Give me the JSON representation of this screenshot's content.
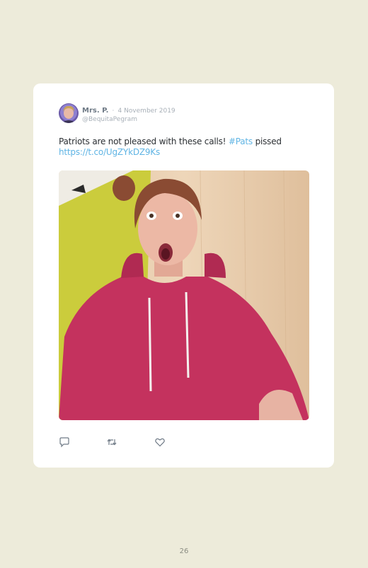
{
  "tweet": {
    "author_name": "Mrs. P.",
    "separator": "·",
    "date": "4 November 2019",
    "handle": "@BequitaPegram",
    "text_main": "Patriots are not pleased with these calls! ",
    "hashtag": "#Pats",
    "text_after_hashtag": " pissed",
    "link": "https://t.co/UgZYkDZ9Ks"
  },
  "icons": {
    "reply": "reply-icon",
    "retweet": "retweet-icon",
    "like": "heart-icon"
  },
  "page": {
    "number": "26"
  },
  "colors": {
    "background": "#edebda",
    "card": "#ffffff",
    "link": "#5fb4e4",
    "name": "#6f7a86",
    "muted": "#a8b0b8"
  }
}
